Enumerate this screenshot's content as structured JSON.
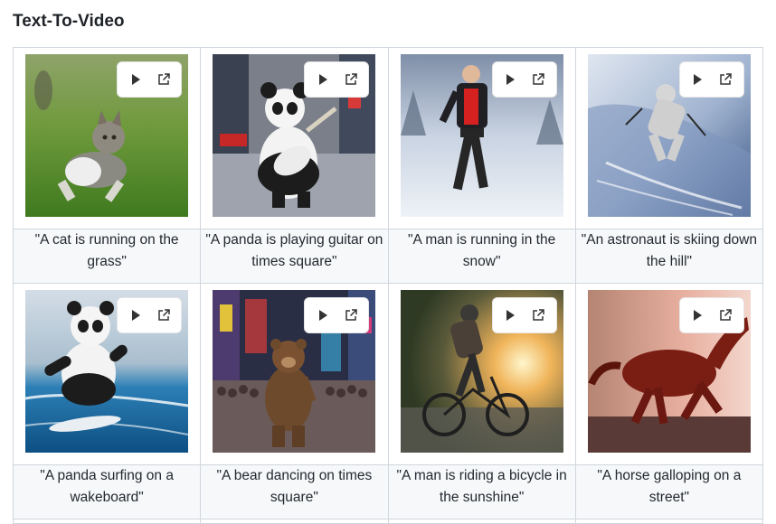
{
  "title": "Text-To-Video",
  "items": [
    {
      "caption": "\"A cat is running on the grass\"",
      "play_icon": "play-icon",
      "open_icon": "external-link-icon"
    },
    {
      "caption": "\"A panda is playing guitar on times square\"",
      "play_icon": "play-icon",
      "open_icon": "external-link-icon"
    },
    {
      "caption": "\"A man is running in the snow\"",
      "play_icon": "play-icon",
      "open_icon": "external-link-icon"
    },
    {
      "caption": "\"An astronaut is skiing down the hill\"",
      "play_icon": "play-icon",
      "open_icon": "external-link-icon"
    },
    {
      "caption": "\"A panda surfing on a wakeboard\"",
      "play_icon": "play-icon",
      "open_icon": "external-link-icon"
    },
    {
      "caption": "\"A bear dancing on times square\"",
      "play_icon": "play-icon",
      "open_icon": "external-link-icon"
    },
    {
      "caption": "\"A man is riding a bicycle in the sunshine\"",
      "play_icon": "play-icon",
      "open_icon": "external-link-icon"
    },
    {
      "caption": "\"A horse galloping on a street\"",
      "play_icon": "play-icon",
      "open_icon": "external-link-icon"
    }
  ]
}
